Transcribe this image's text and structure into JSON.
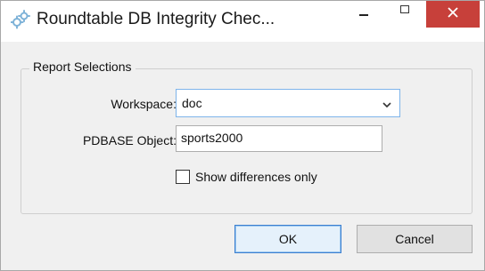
{
  "window": {
    "title": "Roundtable DB Integrity Chec...",
    "app_icon": "gears-icon",
    "controls": {
      "minimize": "minimize-icon",
      "maximize": "maximize-icon",
      "close": "close-icon"
    }
  },
  "group": {
    "title": "Report Selections"
  },
  "form": {
    "workspace_label": "Workspace:",
    "workspace_value": "doc",
    "pdbase_label": "PDBASE Object:",
    "pdbase_value": "sports2000",
    "show_diff_label": "Show differences only",
    "show_diff_checked": false
  },
  "buttons": {
    "ok": "OK",
    "cancel": "Cancel"
  },
  "colors": {
    "close_button": "#c7403a",
    "focus_border": "#3c7fd0"
  }
}
